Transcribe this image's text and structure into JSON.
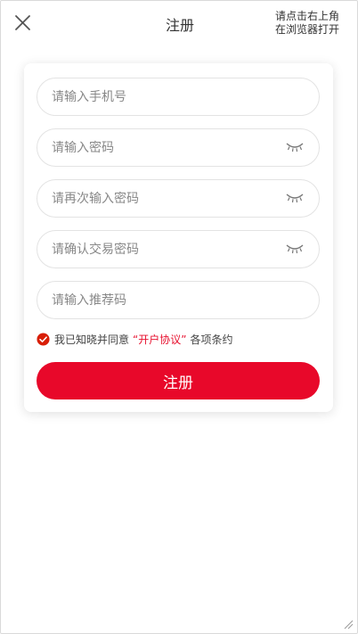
{
  "header": {
    "title": "注册",
    "close_icon": "close-icon",
    "browser_hint": "请点击右上角在浏览器打开"
  },
  "form": {
    "fields": [
      {
        "placeholder": "请输入手机号",
        "has_eye": false
      },
      {
        "placeholder": "请输入密码",
        "has_eye": true
      },
      {
        "placeholder": "请再次输入密码",
        "has_eye": true
      },
      {
        "placeholder": "请确认交易密码",
        "has_eye": true
      },
      {
        "placeholder": "请输入推荐码",
        "has_eye": false
      }
    ],
    "agreement": {
      "checked": true,
      "prefix": "我已知晓并同意",
      "link": "“开户协议”",
      "suffix": "各项条约"
    },
    "submit_label": "注册"
  },
  "colors": {
    "accent": "#e8082a",
    "link": "#e7112f",
    "check": "#d81e06",
    "border": "#e3e3e3"
  }
}
